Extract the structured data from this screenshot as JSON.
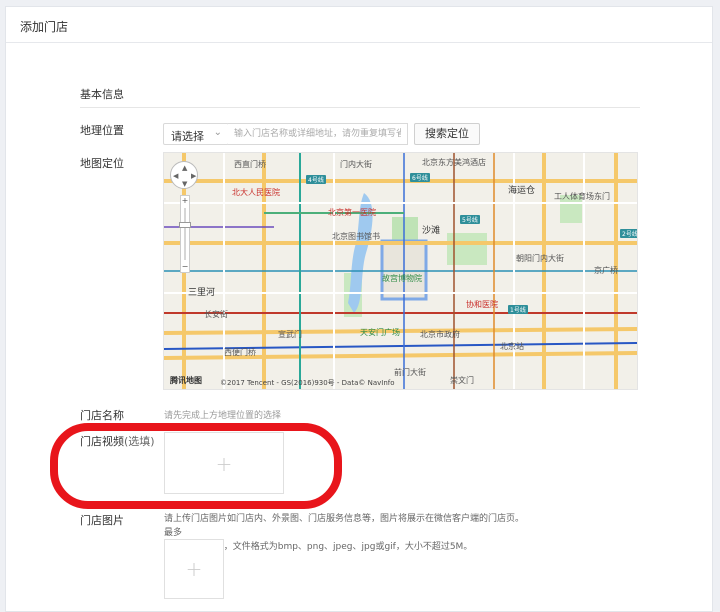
{
  "page": {
    "title": "添加门店"
  },
  "section": {
    "title": "基本信息"
  },
  "location": {
    "label": "地理位置",
    "select_value": "请选择",
    "address_placeholder": "输入门店名称或详细地址，请勿重复填写省市",
    "search_button": "搜索定位"
  },
  "map_location": {
    "label": "地图定位",
    "logo": "腾讯地图",
    "copyright": "©2017 Tencent - GS(2016)930号 - Data© NavInfo",
    "places": {
      "p1": "西直门桥",
      "p2": "门内大街",
      "p3": "北京东方美鸿酒店",
      "p4": "海运仓",
      "p5": "北大人民医院",
      "p6": "北京第一医院",
      "p7": "北京图书馆书",
      "p8": "沙滩",
      "p9": "故宫博物院",
      "p10": "天安门广场",
      "p11": "协和医院",
      "p12": "北京站",
      "p13": "三里河",
      "p14": "宣武门",
      "p15": "西便门桥",
      "p16": "崇文门",
      "p17": "工人体育场东门",
      "p18": "京广桥",
      "p19": "北京市政府",
      "p20": "朝阳门内大街",
      "p21": "长安街",
      "p22": "前门大街"
    },
    "badges": {
      "b1": "4号线",
      "b2": "6号线",
      "b3": "5号线",
      "b4": "2号线",
      "b5": "1号线"
    }
  },
  "store_name": {
    "label": "门店名称",
    "hint": "请先完成上方地理位置的选择"
  },
  "store_video": {
    "label": "门店视频",
    "optional": "(选填)"
  },
  "store_photos": {
    "label": "门店图片",
    "description_line1": "请上传门店图片如门店内、外景图、门店服务信息等，图片将展示在微信客户端的门店页。最多",
    "description_line2": "可上传9个图片，文件格式为bmp、png、jpeg、jpg或gif，大小不超过5M。"
  },
  "upload": {
    "plus": "+"
  },
  "colors": {
    "highlight": "#e8151b",
    "map_red": "#c9302c",
    "map_green": "#2e8b45",
    "metro": "#2f8f9a"
  }
}
